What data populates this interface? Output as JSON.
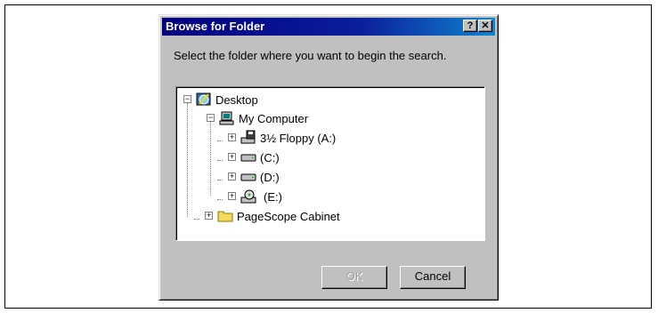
{
  "dialog": {
    "title": "Browse for Folder",
    "help_label": "?",
    "close_label": "✕",
    "instruction": "Select the folder where you want to begin the search.",
    "ok_label": "OK",
    "cancel_label": "Cancel"
  },
  "tree": {
    "items": [
      {
        "label": "Desktop",
        "icon": "desktop-icon",
        "expander": "−"
      },
      {
        "label": "My Computer",
        "icon": "computer-icon",
        "expander": "−"
      },
      {
        "label": "3½ Floppy (A:)",
        "icon": "floppy-drive-icon",
        "expander": "+"
      },
      {
        "label": "(C:)",
        "icon": "hard-drive-icon",
        "expander": "+"
      },
      {
        "label": "(D:)",
        "icon": "hard-drive-icon",
        "expander": "+"
      },
      {
        "label": "(E:)",
        "icon": "cd-drive-icon",
        "expander": "+"
      },
      {
        "label": "PageScope Cabinet",
        "icon": "folder-icon",
        "expander": "+"
      }
    ]
  },
  "colors": {
    "title_bar": "#000080",
    "dialog_face": "#c0c0c0",
    "folder": "#f5d95a"
  }
}
